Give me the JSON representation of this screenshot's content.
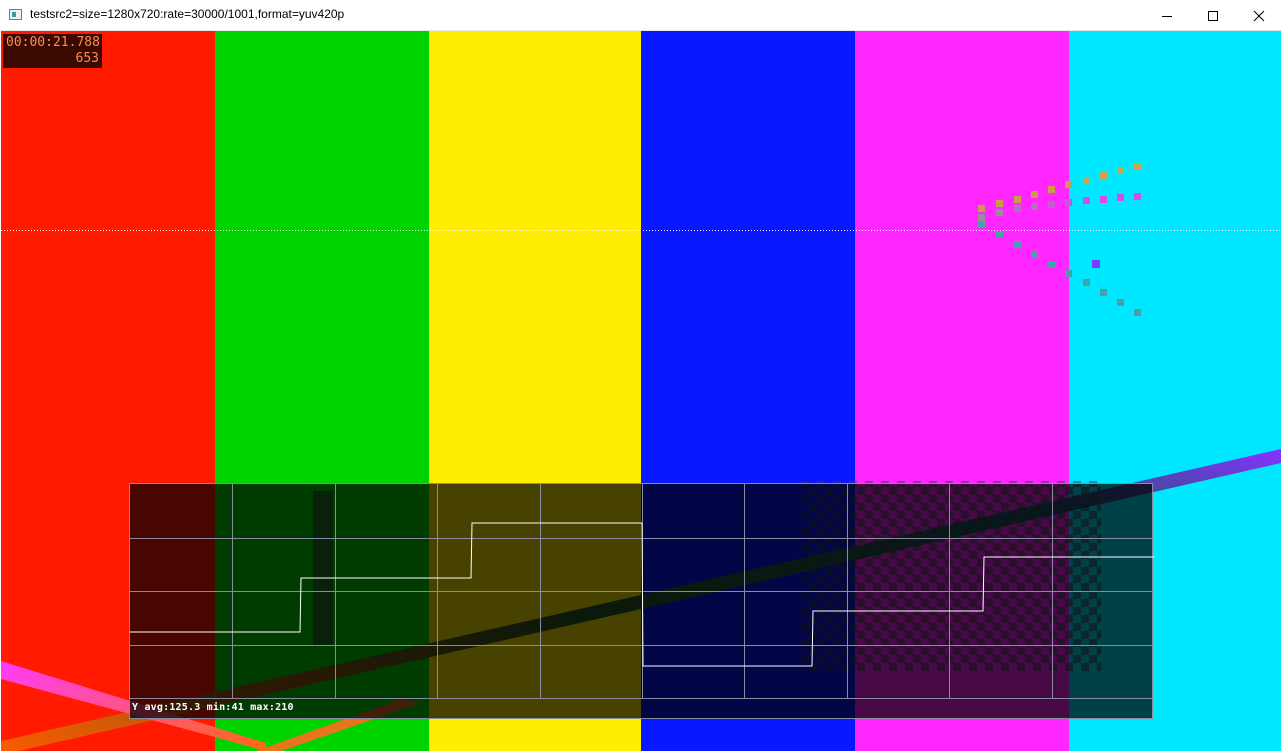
{
  "window": {
    "title": "testsrc2=size=1280x720:rate=30000/1001,format=yuv420p",
    "icons": {
      "app": "video-window-icon",
      "minimize": "minimize-icon",
      "maximize": "maximize-icon",
      "close": "close-icon"
    }
  },
  "overlay": {
    "timecode": "00:00:21.788",
    "frame_number": "653"
  },
  "color_bars": [
    "#ff1a00",
    "#00d400",
    "#ffee00",
    "#0a18ff",
    "#ff26ff",
    "#00e8ff"
  ],
  "scope": {
    "stats": "Y avg:125.3 min:41 max:210",
    "grid_color": "#8a8aa0",
    "trace_color": "#ffffff"
  }
}
